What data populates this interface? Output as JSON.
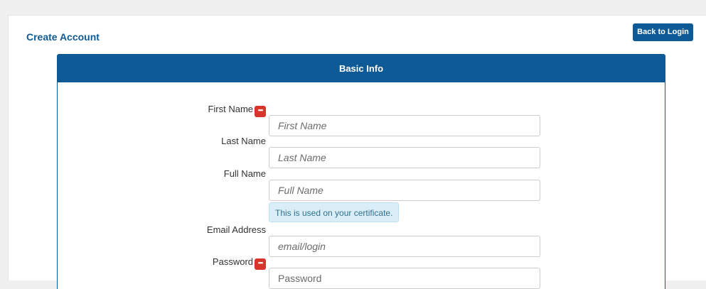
{
  "page": {
    "title": "Create Account",
    "back_button": "Back to Login"
  },
  "panel": {
    "heading": "Basic Info"
  },
  "form": {
    "first_name": {
      "label": "First Name",
      "placeholder": "First Name",
      "required": true
    },
    "last_name": {
      "label": "Last Name",
      "placeholder": "Last Name",
      "required": false
    },
    "full_name": {
      "label": "Full Name",
      "placeholder": "Full Name",
      "required": false,
      "hint": "This is used on your certificate."
    },
    "email": {
      "label": "Email Address",
      "placeholder": "email/login",
      "required": false
    },
    "password": {
      "label": "Password",
      "placeholder": "Password",
      "required": true
    }
  },
  "icons": {
    "required": "ellipsis-icon"
  },
  "colors": {
    "brand": "#0e5a96",
    "required": "#d9342b",
    "hint_bg": "#d9eef7"
  }
}
